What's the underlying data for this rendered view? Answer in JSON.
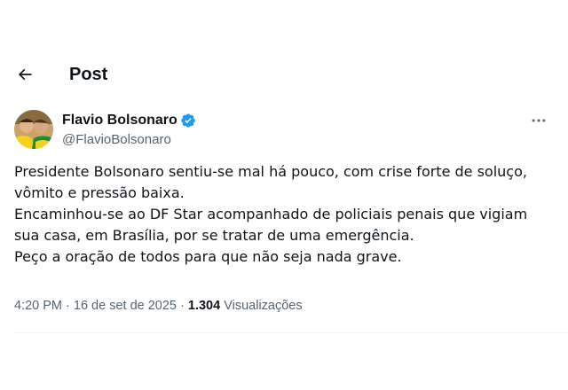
{
  "header": {
    "back_icon": "arrow-left-icon",
    "title": "Post"
  },
  "author": {
    "name": "Flavio Bolsonaro",
    "handle": "@FlavioBolsonaro",
    "verified_icon": "verified-badge-icon",
    "verified_color": "#1d9bf0",
    "more_icon": "more-horizontal-icon"
  },
  "tweet": {
    "lines": [
      "Presidente Bolsonaro sentiu-se mal há pouco, com crise forte de soluço,",
      "vômito e pressão baixa.",
      "Encaminhou-se ao DF Star acompanhado de policiais penais que vigiam",
      "sua casa, em Brasília, por se tratar de uma emergência.",
      "Peço a oração de todos para que não seja nada grave."
    ]
  },
  "meta": {
    "time": "4:20 PM",
    "separator": "·",
    "date": "16 de set de 2025",
    "views_count": "1.304",
    "views_label": "Visualizações"
  },
  "colors": {
    "text_primary": "#0f1419",
    "text_secondary": "#536471",
    "divider": "#eff3f4"
  }
}
